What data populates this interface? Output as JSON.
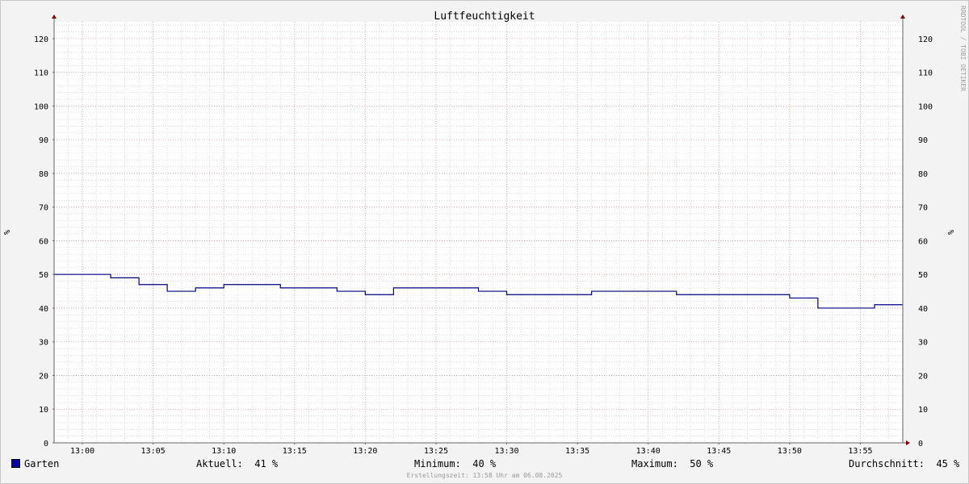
{
  "chart_data": {
    "type": "line",
    "title": "Luftfeuchtigkeit",
    "ylabel": "%",
    "ylim": [
      0,
      125
    ],
    "yticks": [
      0,
      10,
      20,
      30,
      40,
      50,
      60,
      70,
      80,
      90,
      100,
      110,
      120
    ],
    "xticks": [
      "13:00",
      "13:05",
      "13:10",
      "13:15",
      "13:20",
      "13:25",
      "13:30",
      "13:35",
      "13:40",
      "13:45",
      "13:50",
      "13:55"
    ],
    "xlim": [
      "12:58",
      "13:58"
    ],
    "grid": true,
    "step": true,
    "colors": {
      "series": "#000080",
      "major_grid": "#e0a0a0",
      "minor_grid": "#c8c8c8",
      "axis": "#666666",
      "arrow": "#800000",
      "background": "#ffffff"
    },
    "series": [
      {
        "name": "Garten",
        "color": "#0000aa",
        "points": [
          [
            "12:58",
            50
          ],
          [
            "13:02",
            49
          ],
          [
            "13:04",
            47
          ],
          [
            "13:06",
            45
          ],
          [
            "13:08",
            46
          ],
          [
            "13:10",
            47
          ],
          [
            "13:14",
            46
          ],
          [
            "13:18",
            45
          ],
          [
            "13:20",
            44
          ],
          [
            "13:22",
            46
          ],
          [
            "13:28",
            45
          ],
          [
            "13:30",
            44
          ],
          [
            "13:36",
            45
          ],
          [
            "13:42",
            44
          ],
          [
            "13:50",
            43
          ],
          [
            "13:52",
            40
          ],
          [
            "13:56",
            41
          ],
          [
            "13:58",
            41
          ]
        ]
      }
    ]
  },
  "legend": {
    "series_name": "Garten",
    "current": "Aktuell:  41 %",
    "minimum": "Minimum:  40 %",
    "maximum": "Maximum:  50 %",
    "average": "Durchschnitt:  45 %"
  },
  "watermark": "RRDTOOL / TOBI OETIKER",
  "footer": "Erstellungszeit: 13:58 Uhr am 06.08.2025"
}
